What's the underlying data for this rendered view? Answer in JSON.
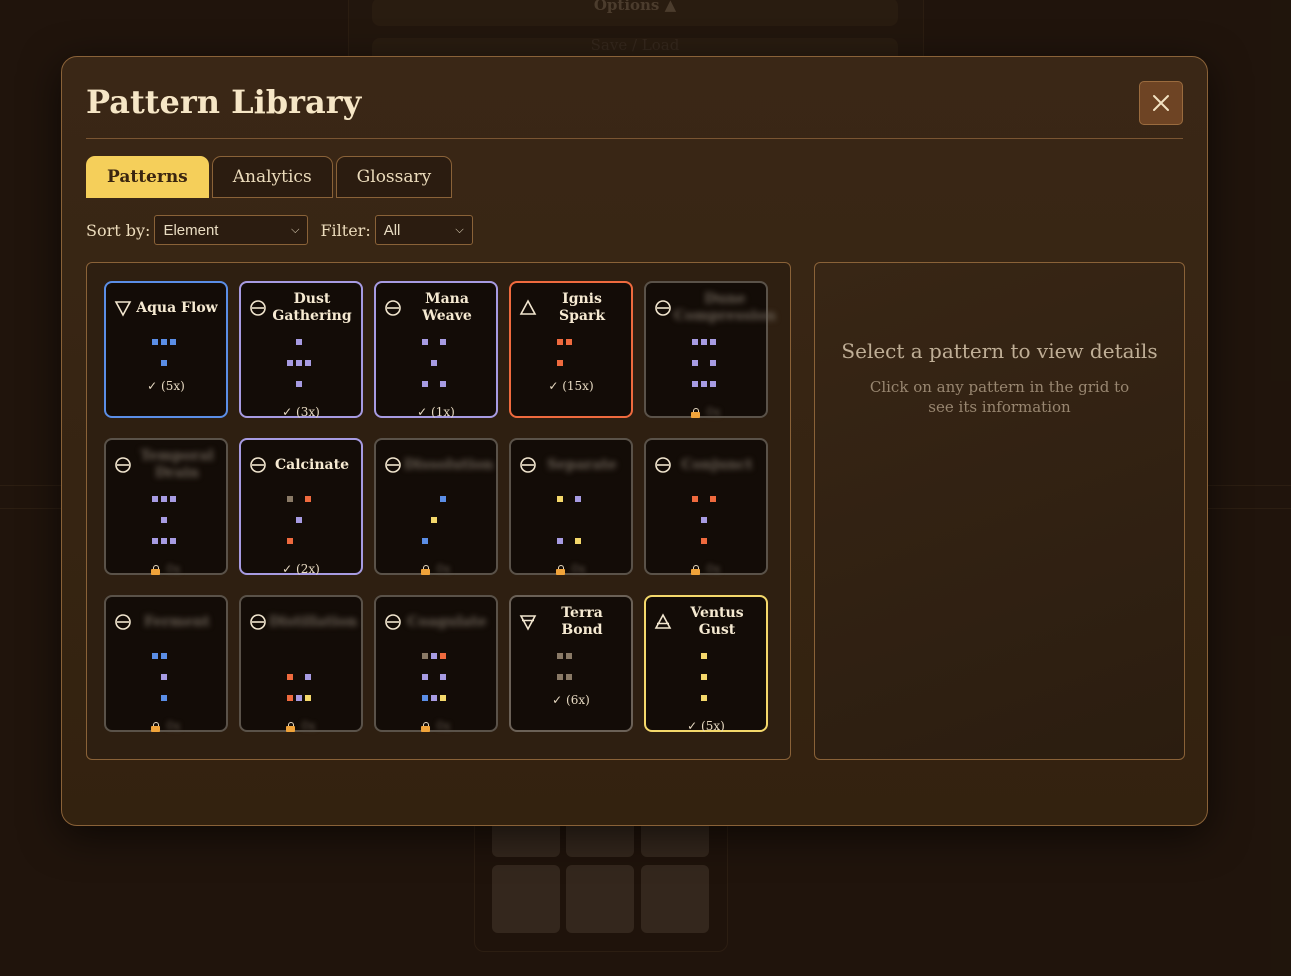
{
  "background": {
    "options_label": "Options ▲",
    "save_load_label": "Save / Load"
  },
  "modal": {
    "title": "Pattern Library",
    "close_label": "×"
  },
  "tabs": [
    {
      "label": "Patterns",
      "active": true
    },
    {
      "label": "Analytics",
      "active": false
    },
    {
      "label": "Glossary",
      "active": false
    }
  ],
  "controls": {
    "sort_label": "Sort by:",
    "sort_value": "Element",
    "filter_label": "Filter:",
    "filter_value": "All"
  },
  "colors": {
    "water": "#5b8ee6",
    "air": "#f4d86b",
    "fire": "#ef6a3e",
    "earth": "#8a7a66",
    "aether": "#a79be2",
    "gold_tab": "#f5cf5a"
  },
  "patterns": [
    {
      "name": "Aqua Flow",
      "symbol": "water-symbol-icon",
      "border": "#5b8ee6",
      "locked": false,
      "status": "✓ (5x)",
      "dots": [
        [
          0,
          0,
          "water"
        ],
        [
          1,
          0,
          "water"
        ],
        [
          2,
          0,
          "water"
        ],
        [
          1,
          1,
          "water"
        ]
      ]
    },
    {
      "name": "Dust Gathering",
      "symbol": "aether-symbol-icon",
      "border": "#a79be2",
      "locked": false,
      "status": "✓ (3x)",
      "dots": [
        [
          1,
          0,
          "aether"
        ],
        [
          0,
          1,
          "aether"
        ],
        [
          1,
          1,
          "aether"
        ],
        [
          2,
          1,
          "aether"
        ],
        [
          1,
          2,
          "aether"
        ]
      ]
    },
    {
      "name": "Mana Weave",
      "symbol": "aether-symbol-icon",
      "border": "#a79be2",
      "locked": false,
      "status": "✓ (1x)",
      "dots": [
        [
          0,
          0,
          "aether"
        ],
        [
          2,
          0,
          "aether"
        ],
        [
          1,
          1,
          "aether"
        ],
        [
          0,
          2,
          "aether"
        ],
        [
          2,
          2,
          "aether"
        ]
      ]
    },
    {
      "name": "Ignis Spark",
      "symbol": "fire-symbol-icon",
      "border": "#ef6a3e",
      "locked": false,
      "status": "✓ (15x)",
      "dots": [
        [
          0,
          0,
          "fire"
        ],
        [
          1,
          0,
          "fire"
        ],
        [
          0,
          1,
          "fire"
        ]
      ]
    },
    {
      "name": "Dune Compression",
      "symbol": "aether-symbol-icon",
      "border": "#5a5249",
      "locked": true,
      "status": "",
      "dots": [
        [
          0,
          0,
          "aether"
        ],
        [
          1,
          0,
          "aether"
        ],
        [
          2,
          0,
          "aether"
        ],
        [
          0,
          1,
          "aether"
        ],
        [
          2,
          1,
          "aether"
        ],
        [
          0,
          2,
          "aether"
        ],
        [
          1,
          2,
          "aether"
        ],
        [
          2,
          2,
          "aether"
        ]
      ]
    },
    {
      "name": "Temporal Drain",
      "symbol": "aether-symbol-icon",
      "border": "#5a5249",
      "locked": true,
      "status": "",
      "dots": [
        [
          0,
          0,
          "aether"
        ],
        [
          1,
          0,
          "aether"
        ],
        [
          2,
          0,
          "aether"
        ],
        [
          1,
          1,
          "aether"
        ],
        [
          0,
          2,
          "aether"
        ],
        [
          1,
          2,
          "aether"
        ],
        [
          2,
          2,
          "aether"
        ]
      ]
    },
    {
      "name": "Calcinate",
      "symbol": "aether-symbol-icon",
      "border": "#a79be2",
      "locked": false,
      "status": "✓ (2x)",
      "dots": [
        [
          0,
          0,
          "earth"
        ],
        [
          2,
          0,
          "fire"
        ],
        [
          1,
          1,
          "aether"
        ],
        [
          0,
          2,
          "fire"
        ]
      ]
    },
    {
      "name": "Dissolution",
      "symbol": "aether-symbol-icon",
      "border": "#5a5249",
      "locked": true,
      "status": "",
      "dots": [
        [
          2,
          0,
          "water"
        ],
        [
          1,
          1,
          "air"
        ],
        [
          0,
          2,
          "water"
        ]
      ]
    },
    {
      "name": "Separate",
      "symbol": "aether-symbol-icon",
      "border": "#5a5249",
      "locked": true,
      "status": "",
      "dots": [
        [
          0,
          0,
          "air"
        ],
        [
          2,
          0,
          "aether"
        ],
        [
          0,
          2,
          "aether"
        ],
        [
          2,
          2,
          "air"
        ]
      ]
    },
    {
      "name": "Conjunct",
      "symbol": "aether-symbol-icon",
      "border": "#5a5249",
      "locked": true,
      "status": "",
      "dots": [
        [
          0,
          0,
          "fire"
        ],
        [
          2,
          0,
          "fire"
        ],
        [
          1,
          1,
          "aether"
        ],
        [
          1,
          2,
          "fire"
        ]
      ]
    },
    {
      "name": "Ferment",
      "symbol": "aether-symbol-icon",
      "border": "#5a5249",
      "locked": true,
      "status": "",
      "dots": [
        [
          0,
          0,
          "water"
        ],
        [
          1,
          0,
          "water"
        ],
        [
          1,
          1,
          "aether"
        ],
        [
          1,
          2,
          "water"
        ]
      ]
    },
    {
      "name": "Distillation",
      "symbol": "aether-symbol-icon",
      "border": "#5a5249",
      "locked": true,
      "status": "",
      "dots": [
        [
          0,
          1,
          "fire"
        ],
        [
          2,
          1,
          "aether"
        ],
        [
          0,
          2,
          "fire"
        ],
        [
          1,
          2,
          "aether"
        ],
        [
          2,
          2,
          "air"
        ]
      ]
    },
    {
      "name": "Coagulate",
      "symbol": "aether-symbol-icon",
      "border": "#5a5249",
      "locked": true,
      "status": "",
      "dots": [
        [
          0,
          0,
          "earth"
        ],
        [
          1,
          0,
          "aether"
        ],
        [
          2,
          0,
          "fire"
        ],
        [
          0,
          1,
          "aether"
        ],
        [
          2,
          1,
          "aether"
        ],
        [
          0,
          2,
          "water"
        ],
        [
          1,
          2,
          "aether"
        ],
        [
          2,
          2,
          "air"
        ]
      ]
    },
    {
      "name": "Terra Bond",
      "symbol": "earth-symbol-icon",
      "border": "#6b6157",
      "locked": false,
      "status": "✓ (6x)",
      "dots": [
        [
          0,
          0,
          "earth"
        ],
        [
          1,
          0,
          "earth"
        ],
        [
          0,
          1,
          "earth"
        ],
        [
          1,
          1,
          "earth"
        ]
      ]
    },
    {
      "name": "Ventus Gust",
      "symbol": "air-symbol-icon",
      "border": "#f4d86b",
      "locked": false,
      "status": "✓ (5x)",
      "dots": [
        [
          1,
          0,
          "air"
        ],
        [
          1,
          1,
          "air"
        ],
        [
          1,
          2,
          "air"
        ]
      ]
    }
  ],
  "detail": {
    "title": "Select a pattern to view details",
    "subtitle": "Click on any pattern in the grid to see its information"
  }
}
